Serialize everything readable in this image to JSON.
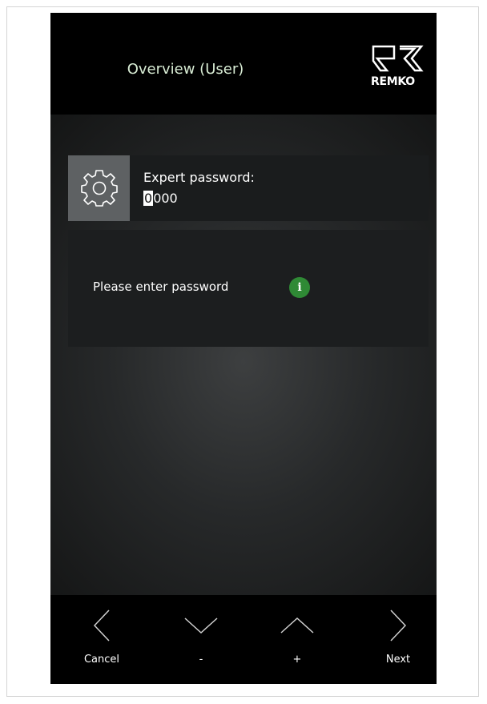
{
  "header": {
    "title": "Overview (User)",
    "logo_text": "REMKO"
  },
  "password": {
    "label": "Expert password:",
    "cursor_digit": "0",
    "remaining_digits": "000",
    "icon": "gear-icon"
  },
  "message": {
    "text": "Please enter password",
    "icon": "info-icon",
    "icon_glyph": "i"
  },
  "footer": {
    "cancel_label": "Cancel",
    "minus_label": "-",
    "plus_label": "+",
    "next_label": "Next"
  },
  "colors": {
    "header_bg": "#000000",
    "title_color": "#d8ecd4",
    "info_green": "#2f8a35",
    "gear_box": "#5e6163"
  }
}
